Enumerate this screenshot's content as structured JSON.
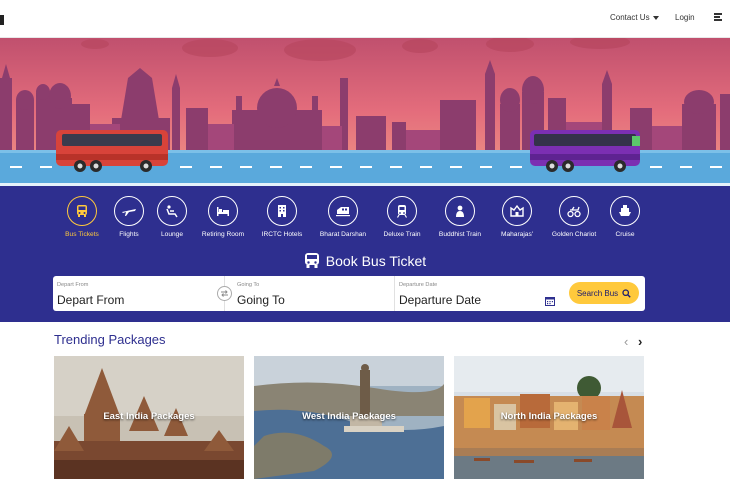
{
  "nav": {
    "contact_label": "Contact Us",
    "login_label": "Login"
  },
  "categories": [
    {
      "label": "Bus Tickets",
      "icon": "bus-icon",
      "active": true
    },
    {
      "label": "Flights",
      "icon": "airplane-icon"
    },
    {
      "label": "Lounge",
      "icon": "lounge-icon"
    },
    {
      "label": "Retiring Room",
      "icon": "bed-icon"
    },
    {
      "label": "IRCTC Hotels",
      "icon": "hotel-icon"
    },
    {
      "label": "Bharat Darshan",
      "icon": "train-icon"
    },
    {
      "label": "Deluxe Train",
      "icon": "deluxe-train-icon"
    },
    {
      "label": "Buddhist Train",
      "icon": "buddha-icon"
    },
    {
      "label": "Maharajas'",
      "icon": "maharaja-icon"
    },
    {
      "label": "Golden Chariot",
      "icon": "chariot-icon"
    },
    {
      "label": "Cruise",
      "icon": "cruise-icon"
    }
  ],
  "booking": {
    "title": "Book Bus Ticket",
    "from_caption": "Depart From",
    "from_value": "Depart From",
    "to_caption": "Going To",
    "to_value": "Going To",
    "date_caption": "Departure Date",
    "date_value": "Departure Date",
    "search_label": "Search Bus"
  },
  "trending": {
    "title": "Trending Packages",
    "prev": "‹",
    "next": "›",
    "packages": [
      {
        "label": "East India Packages"
      },
      {
        "label": "West India Packages"
      },
      {
        "label": "North India Packages"
      }
    ]
  },
  "colors": {
    "panel": "#2e2f8f",
    "accent": "#ffc93c",
    "sky_top": "#e06a7e",
    "road": "#5aa9dc"
  }
}
